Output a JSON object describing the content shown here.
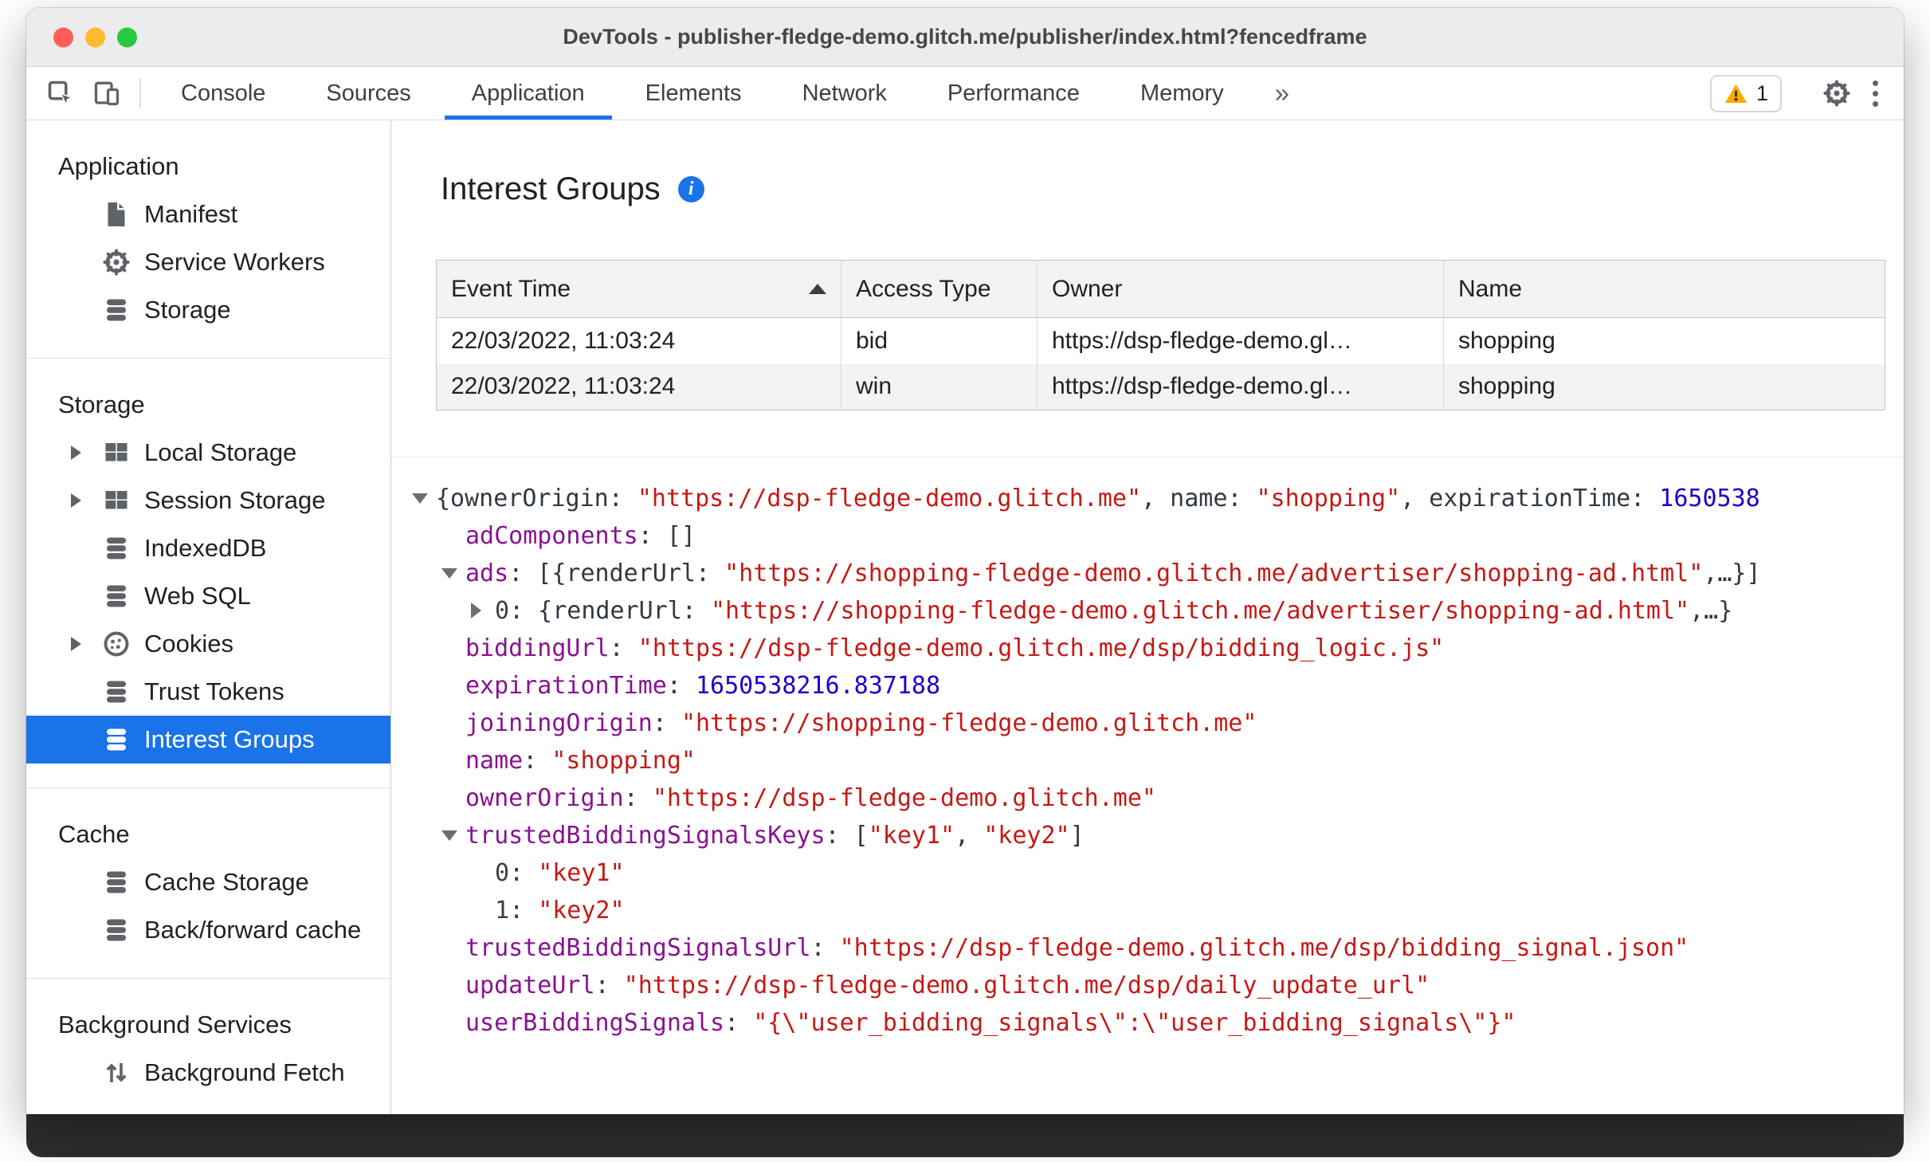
{
  "window": {
    "title": "DevTools - publisher-fledge-demo.glitch.me/publisher/index.html?fencedframe"
  },
  "colors": {
    "accent_blue": "#1a73e8",
    "selected_item_bg": "#1a73e8",
    "warning_yellow": "#f9ab00",
    "json_key": "#881391",
    "json_string": "#c41a16",
    "json_number": "#1c00cf",
    "table_header_bg": "#f1f3f4"
  },
  "toolbar": {
    "tabs": [
      {
        "label": "Console"
      },
      {
        "label": "Sources"
      },
      {
        "label": "Application"
      },
      {
        "label": "Elements"
      },
      {
        "label": "Network"
      },
      {
        "label": "Performance"
      },
      {
        "label": "Memory"
      }
    ],
    "active_tab": "Application",
    "more_tabs_label": "»",
    "warning_count": "1",
    "icons": [
      "inspect-icon",
      "device-toolbar-icon",
      "warning-icon",
      "settings-gear-icon",
      "more-menu-icon"
    ]
  },
  "sidebar": {
    "sections": [
      {
        "title": "Application",
        "items": [
          {
            "label": "Manifest",
            "icon": "manifest-icon"
          },
          {
            "label": "Service Workers",
            "icon": "service-workers-gear-icon"
          },
          {
            "label": "Storage",
            "icon": "storage-database-icon"
          }
        ]
      },
      {
        "title": "Storage",
        "items": [
          {
            "label": "Local Storage",
            "icon": "table-grid-icon",
            "expander": true
          },
          {
            "label": "Session Storage",
            "icon": "table-grid-icon",
            "expander": true
          },
          {
            "label": "IndexedDB",
            "icon": "storage-database-icon"
          },
          {
            "label": "Web SQL",
            "icon": "storage-database-icon"
          },
          {
            "label": "Cookies",
            "icon": "cookie-icon",
            "expander": true
          },
          {
            "label": "Trust Tokens",
            "icon": "storage-database-icon"
          },
          {
            "label": "Interest Groups",
            "icon": "storage-database-icon",
            "selected": true
          }
        ]
      },
      {
        "title": "Cache",
        "items": [
          {
            "label": "Cache Storage",
            "icon": "storage-database-icon"
          },
          {
            "label": "Back/forward cache",
            "icon": "storage-database-icon"
          }
        ]
      },
      {
        "title": "Background Services",
        "items": [
          {
            "label": "Background Fetch",
            "icon": "background-fetch-icon"
          }
        ]
      }
    ]
  },
  "main": {
    "title": "Interest Groups",
    "table": {
      "columns": [
        "Event Time",
        "Access Type",
        "Owner",
        "Name"
      ],
      "sort": {
        "column": "Event Time",
        "direction": "asc"
      },
      "rows": [
        [
          "22/03/2022, 11:03:24",
          "bid",
          "https://dsp-fledge-demo.gl…",
          "shopping"
        ],
        [
          "22/03/2022, 11:03:24",
          "win",
          "https://dsp-fledge-demo.gl…",
          "shopping"
        ]
      ]
    },
    "tree": {
      "lines": [
        {
          "indent": 0,
          "arrow": "down",
          "segments": [
            {
              "c": "plain",
              "t": "{ownerOrigin: "
            },
            {
              "c": "str",
              "t": "\"https://dsp-fledge-demo.glitch.me\""
            },
            {
              "c": "plain",
              "t": ", name: "
            },
            {
              "c": "str",
              "t": "\"shopping\""
            },
            {
              "c": "plain",
              "t": ", expirationTime: "
            },
            {
              "c": "num",
              "t": "1650538"
            }
          ]
        },
        {
          "indent": 1,
          "arrow": null,
          "segments": [
            {
              "c": "key",
              "t": "adComponents"
            },
            {
              "c": "plain",
              "t": ": []"
            }
          ]
        },
        {
          "indent": 1,
          "arrow": "down",
          "segments": [
            {
              "c": "key",
              "t": "ads"
            },
            {
              "c": "plain",
              "t": ": [{renderUrl: "
            },
            {
              "c": "str",
              "t": "\"https://shopping-fledge-demo.glitch.me/advertiser/shopping-ad.html\""
            },
            {
              "c": "plain",
              "t": ",…}]"
            }
          ]
        },
        {
          "indent": 2,
          "arrow": "right",
          "segments": [
            {
              "c": "idx",
              "t": "0"
            },
            {
              "c": "plain",
              "t": ": {renderUrl: "
            },
            {
              "c": "str",
              "t": "\"https://shopping-fledge-demo.glitch.me/advertiser/shopping-ad.html\""
            },
            {
              "c": "plain",
              "t": ",…}"
            }
          ]
        },
        {
          "indent": 1,
          "arrow": null,
          "segments": [
            {
              "c": "key",
              "t": "biddingUrl"
            },
            {
              "c": "plain",
              "t": ": "
            },
            {
              "c": "str",
              "t": "\"https://dsp-fledge-demo.glitch.me/dsp/bidding_logic.js\""
            }
          ]
        },
        {
          "indent": 1,
          "arrow": null,
          "segments": [
            {
              "c": "key",
              "t": "expirationTime"
            },
            {
              "c": "plain",
              "t": ": "
            },
            {
              "c": "num",
              "t": "1650538216.837188"
            }
          ]
        },
        {
          "indent": 1,
          "arrow": null,
          "segments": [
            {
              "c": "key",
              "t": "joiningOrigin"
            },
            {
              "c": "plain",
              "t": ": "
            },
            {
              "c": "str",
              "t": "\"https://shopping-fledge-demo.glitch.me\""
            }
          ]
        },
        {
          "indent": 1,
          "arrow": null,
          "segments": [
            {
              "c": "key",
              "t": "name"
            },
            {
              "c": "plain",
              "t": ": "
            },
            {
              "c": "str",
              "t": "\"shopping\""
            }
          ]
        },
        {
          "indent": 1,
          "arrow": null,
          "segments": [
            {
              "c": "key",
              "t": "ownerOrigin"
            },
            {
              "c": "plain",
              "t": ": "
            },
            {
              "c": "str",
              "t": "\"https://dsp-fledge-demo.glitch.me\""
            }
          ]
        },
        {
          "indent": 1,
          "arrow": "down",
          "segments": [
            {
              "c": "key",
              "t": "trustedBiddingSignalsKeys"
            },
            {
              "c": "plain",
              "t": ": ["
            },
            {
              "c": "str",
              "t": "\"key1\""
            },
            {
              "c": "plain",
              "t": ", "
            },
            {
              "c": "str",
              "t": "\"key2\""
            },
            {
              "c": "plain",
              "t": "]"
            }
          ]
        },
        {
          "indent": 2,
          "arrow": null,
          "segments": [
            {
              "c": "idx",
              "t": "0"
            },
            {
              "c": "plain",
              "t": ": "
            },
            {
              "c": "str",
              "t": "\"key1\""
            }
          ]
        },
        {
          "indent": 2,
          "arrow": null,
          "segments": [
            {
              "c": "idx",
              "t": "1"
            },
            {
              "c": "plain",
              "t": ": "
            },
            {
              "c": "str",
              "t": "\"key2\""
            }
          ]
        },
        {
          "indent": 1,
          "arrow": null,
          "segments": [
            {
              "c": "key",
              "t": "trustedBiddingSignalsUrl"
            },
            {
              "c": "plain",
              "t": ": "
            },
            {
              "c": "str",
              "t": "\"https://dsp-fledge-demo.glitch.me/dsp/bidding_signal.json\""
            }
          ]
        },
        {
          "indent": 1,
          "arrow": null,
          "segments": [
            {
              "c": "key",
              "t": "updateUrl"
            },
            {
              "c": "plain",
              "t": ": "
            },
            {
              "c": "str",
              "t": "\"https://dsp-fledge-demo.glitch.me/dsp/daily_update_url\""
            }
          ]
        },
        {
          "indent": 1,
          "arrow": null,
          "segments": [
            {
              "c": "key",
              "t": "userBiddingSignals"
            },
            {
              "c": "plain",
              "t": ": "
            },
            {
              "c": "str",
              "t": "\"{\\\"user_bidding_signals\\\":\\\"user_bidding_signals\\\"}\""
            }
          ]
        }
      ]
    }
  }
}
